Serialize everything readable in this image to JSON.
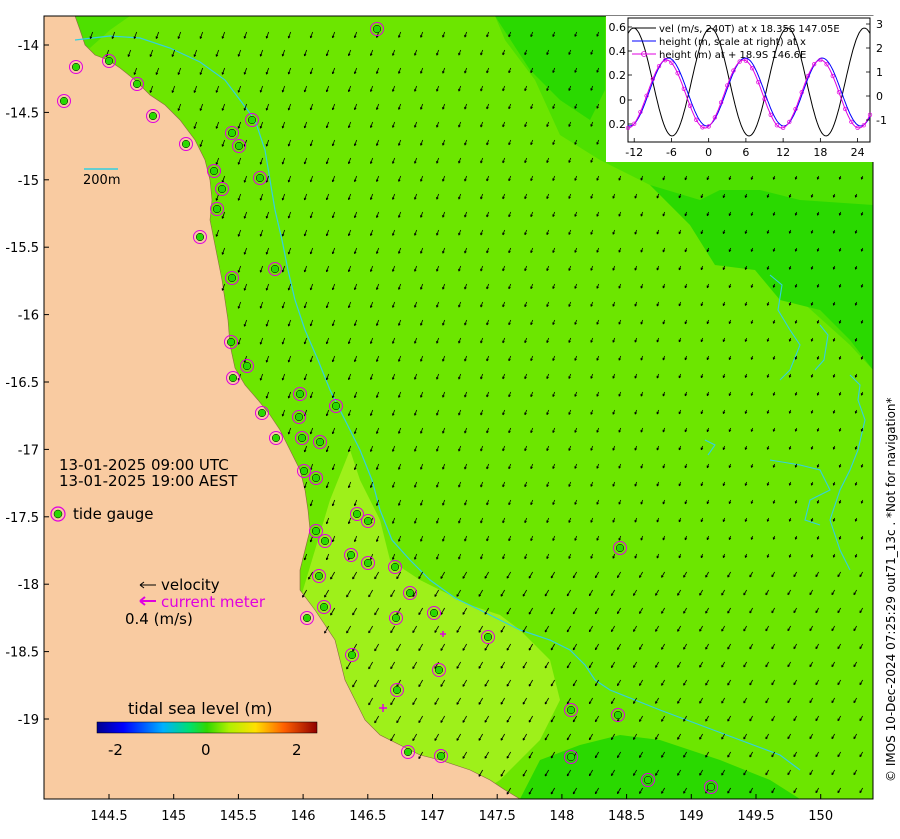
{
  "map": {
    "xticks": [
      "144.5",
      "145",
      "145.5",
      "146",
      "146.5",
      "147",
      "147.5",
      "148",
      "148.5",
      "149",
      "149.5",
      "150"
    ],
    "yticks": [
      "-14",
      "-14.5",
      "-15",
      "-15.5",
      "-16",
      "-16.5",
      "-17",
      "-17.5",
      "-18",
      "-18.5",
      "-19"
    ],
    "scale_label": "200m",
    "time_utc": "13-01-2025 09:00 UTC",
    "time_local": "13-01-2025 19:00 AEST",
    "legend_tide_gauge": "tide gauge",
    "legend_velocity": "velocity",
    "legend_current_meter": "current meter",
    "velocity_scale": "0.4 (m/s)",
    "colorbar_title": "tidal sea level (m)",
    "colorbar_ticks": [
      "-2",
      "0",
      "2"
    ],
    "credit": "© IMOS 10-Dec-2024 07:25:29 out71_13c . *Not for navigation*",
    "colors": {
      "land": "#f9cba1",
      "sea": "#6ce600",
      "deep_green": "#2ad900",
      "mid_green": "#4ee000",
      "yellow_green": "#9ef01a",
      "isobath": "#34d0e0",
      "gauge_ring": "#e000e0",
      "arrow": "#000000"
    }
  },
  "inset": {
    "legend": [
      "vel (m/s, 240T) at x 18.35S 147.05E",
      "height (m, scale at right) at x",
      "height (m) at + 18.9S 146.6E"
    ],
    "xticks": [
      "-12",
      "-6",
      "0",
      "6",
      "12",
      "18",
      "24"
    ],
    "yticks_left": [
      "0.6",
      "0.4",
      "0.2",
      "0",
      "0.2"
    ],
    "yticks_right": [
      "3",
      "2",
      "1",
      "0",
      "-1"
    ]
  }
}
